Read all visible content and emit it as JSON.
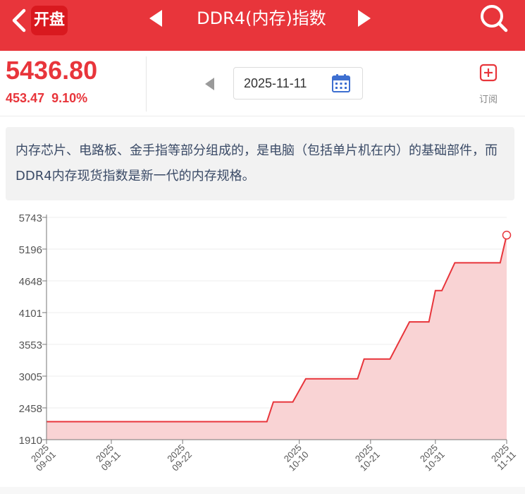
{
  "header": {
    "logo_text": "开盘",
    "title": "DDR4(内存)指数",
    "icons": [
      "back-chevron-icon",
      "prev-triangle-icon",
      "next-triangle-icon",
      "search-icon"
    ],
    "bg_color": "#e8353b"
  },
  "quote": {
    "price": "5436.80",
    "change": "453.47",
    "change_pct": "9.10%",
    "color": "#e8353b"
  },
  "date_picker": {
    "date": "2025-11-11",
    "icons": [
      "prev-triangle-icon",
      "calendar-icon"
    ]
  },
  "subscribe": {
    "label": "订阅",
    "icon": "plus-box-icon"
  },
  "description": {
    "text": "内存芯片、电路板、金手指等部分组成的，是电脑（包括单片机在内）的基础部件，而DDR4内存现货指数是新一代的内存规格。"
  },
  "chart_data": {
    "type": "area",
    "line_color": "#e8353b",
    "fill_color": "#f9d3d4",
    "ylim": [
      1910,
      5743
    ],
    "y_ticks": [
      "5743",
      "5196",
      "4648",
      "4101",
      "3553",
      "3005",
      "2458",
      "1910"
    ],
    "x_ticks": [
      "2025\n09-01",
      "2025\n09-11",
      "2025\n09-22",
      "2025\n10-10",
      "2025\n10-21",
      "2025\n10-31",
      "2025\n11-11"
    ],
    "x_tick_dates": [
      "2025-09-01",
      "2025-09-11",
      "2025-09-22",
      "2025-10-10",
      "2025-10-21",
      "2025-10-31",
      "2025-11-11"
    ],
    "series": [
      {
        "points": [
          [
            "2025-09-01",
            2220
          ],
          [
            "2025-10-05",
            2220
          ],
          [
            "2025-10-06",
            2560
          ],
          [
            "2025-10-09",
            2560
          ],
          [
            "2025-10-11",
            2960
          ],
          [
            "2025-10-14",
            2960
          ],
          [
            "2025-10-16",
            2960
          ],
          [
            "2025-10-19",
            2960
          ],
          [
            "2025-10-20",
            3300
          ],
          [
            "2025-10-22",
            3300
          ],
          [
            "2025-10-24",
            3300
          ],
          [
            "2025-10-27",
            3940
          ],
          [
            "2025-10-30",
            3940
          ],
          [
            "2025-10-31",
            4480
          ],
          [
            "2025-11-01",
            4480
          ],
          [
            "2025-11-03",
            4960
          ],
          [
            "2025-11-05",
            4960
          ],
          [
            "2025-11-07",
            4960
          ],
          [
            "2025-11-10",
            4960
          ],
          [
            "2025-11-11",
            5436.8
          ]
        ]
      }
    ],
    "last_point_marker": true,
    "grid": true
  }
}
